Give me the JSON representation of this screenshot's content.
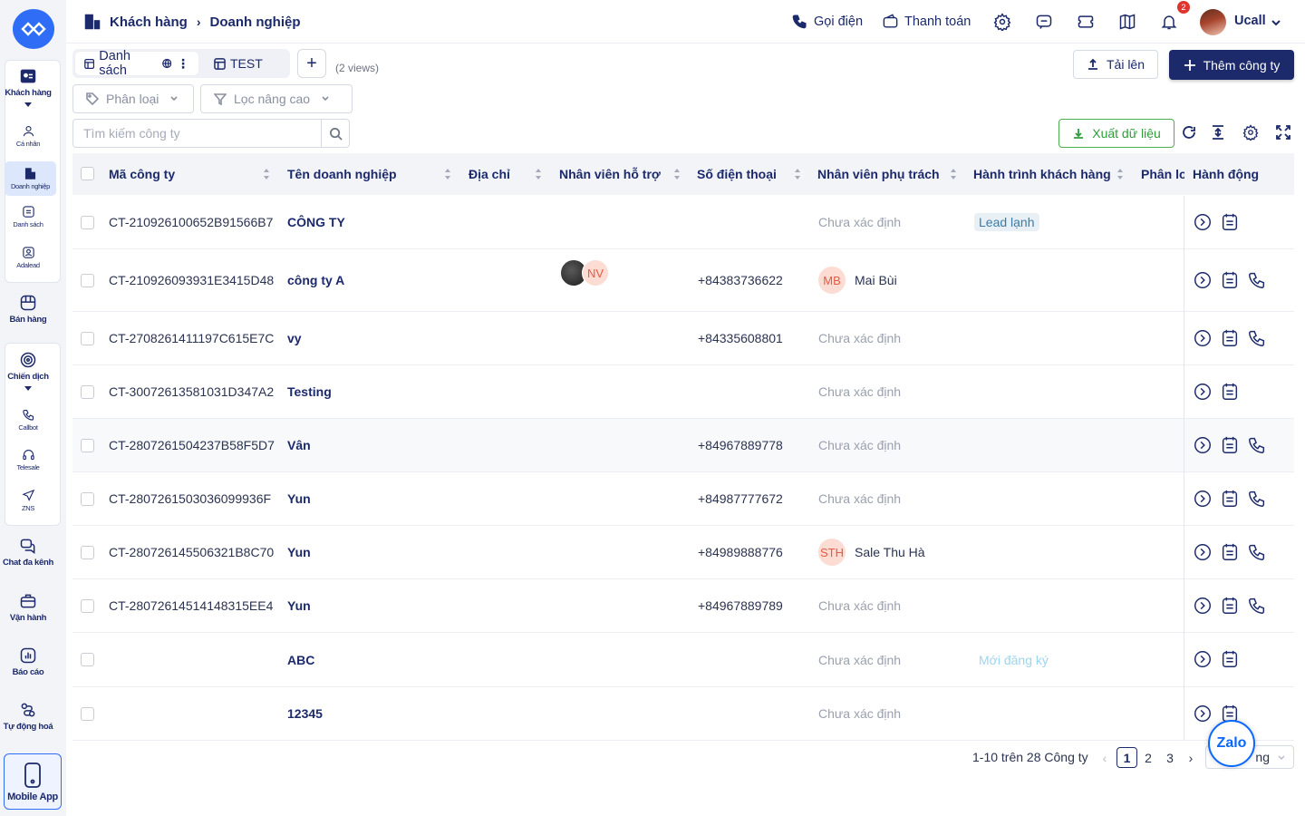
{
  "sidebar": {
    "items": [
      {
        "label": "Khách hàng",
        "icon": "customer-card-icon"
      },
      {
        "label": "Cá nhân",
        "icon": "person-icon"
      },
      {
        "label": "Doanh nghiệp",
        "icon": "company-icon"
      },
      {
        "label": "Danh sách",
        "icon": "list-icon"
      },
      {
        "label": "Adalead",
        "icon": "adalead-icon"
      },
      {
        "label": "Bán hàng",
        "icon": "shop-icon"
      },
      {
        "label": "Chiến dịch",
        "icon": "campaign-icon"
      },
      {
        "label": "Callbot",
        "icon": "callbot-icon"
      },
      {
        "label": "Telesale",
        "icon": "headset-icon"
      },
      {
        "label": "ZNS",
        "icon": "send-icon"
      },
      {
        "label": "Chat đa kênh",
        "icon": "chat-icon"
      },
      {
        "label": "Vận hành",
        "icon": "briefcase-icon"
      },
      {
        "label": "Báo cáo",
        "icon": "report-icon"
      },
      {
        "label": "Tự động hoá",
        "icon": "automation-icon"
      }
    ],
    "mobile_app": "Mobile App"
  },
  "header": {
    "breadcrumb": [
      "Khách hàng",
      "Doanh nghiệp"
    ],
    "call_label": "Gọi điện",
    "payment_label": "Thanh toán",
    "notification_count": "2",
    "user_name": "Ucall"
  },
  "views": {
    "tabs": [
      "Danh sách",
      "TEST"
    ],
    "count": "(2 views)"
  },
  "toolbar": {
    "upload_label": "Tải lên",
    "add_label": "Thêm công ty",
    "filter_type": "Phân loại",
    "filter_advanced": "Lọc nâng cao",
    "export_label": "Xuất dữ liệu"
  },
  "search": {
    "placeholder": "Tìm kiếm công ty",
    "value": ""
  },
  "table": {
    "columns": [
      "Mã công ty",
      "Tên doanh nghiệp",
      "Địa chỉ",
      "Nhân viên hỗ trợ",
      "Số điện thoại",
      "Nhân viên phụ trách",
      "Hành trình khách hàng",
      "Phân loại",
      "Hành động"
    ],
    "rows": [
      {
        "code": "CT-210926100652B91566B7",
        "name": "CÔNG TY",
        "phone": "",
        "owner": "Chưa xác định",
        "owner_initials": "",
        "journey": "Lead lạnh",
        "support": []
      },
      {
        "code": "CT-210926093931E3415D48",
        "name": "công ty A",
        "phone": "+84383736622",
        "owner": "Mai Bùi",
        "owner_initials": "MB",
        "journey": "",
        "support": [
          "NV"
        ]
      },
      {
        "code": "CT-2708261411197C615E7C",
        "name": "vy",
        "phone": "+84335608801",
        "owner": "Chưa xác định",
        "owner_initials": "",
        "journey": "",
        "support": []
      },
      {
        "code": "CT-30072613581031D347A2",
        "name": "Testing",
        "phone": "",
        "owner": "Chưa xác định",
        "owner_initials": "",
        "journey": "",
        "support": []
      },
      {
        "code": "CT-2807261504237B58F5D7",
        "name": "Vân",
        "phone": "+84967889778",
        "owner": "Chưa xác định",
        "owner_initials": "",
        "journey": "",
        "support": []
      },
      {
        "code": "CT-2807261503036099936F",
        "name": "Yun",
        "phone": "+84987777672",
        "owner": "Chưa xác định",
        "owner_initials": "",
        "journey": "",
        "support": []
      },
      {
        "code": "CT-280726145506321B8C70",
        "name": "Yun",
        "phone": "+84989888776",
        "owner": "Sale Thu Hà",
        "owner_initials": "STH",
        "journey": "",
        "support": []
      },
      {
        "code": "CT-28072614514148315EE4",
        "name": "Yun",
        "phone": "+84967889789",
        "owner": "Chưa xác định",
        "owner_initials": "",
        "journey": "",
        "support": []
      },
      {
        "code": "",
        "name": "ABC",
        "phone": "",
        "owner": "Chưa xác định",
        "owner_initials": "",
        "journey": "Mới đăng ký",
        "support": []
      },
      {
        "code": "",
        "name": "12345",
        "phone": "",
        "owner": "Chưa xác định",
        "owner_initials": "",
        "journey": "",
        "support": []
      }
    ]
  },
  "pagination": {
    "summary": "1-10 trên 28 Công ty",
    "pages": [
      "1",
      "2",
      "3"
    ],
    "current": "1",
    "page_size_label": "ng"
  },
  "zalo_label": "Zalo"
}
